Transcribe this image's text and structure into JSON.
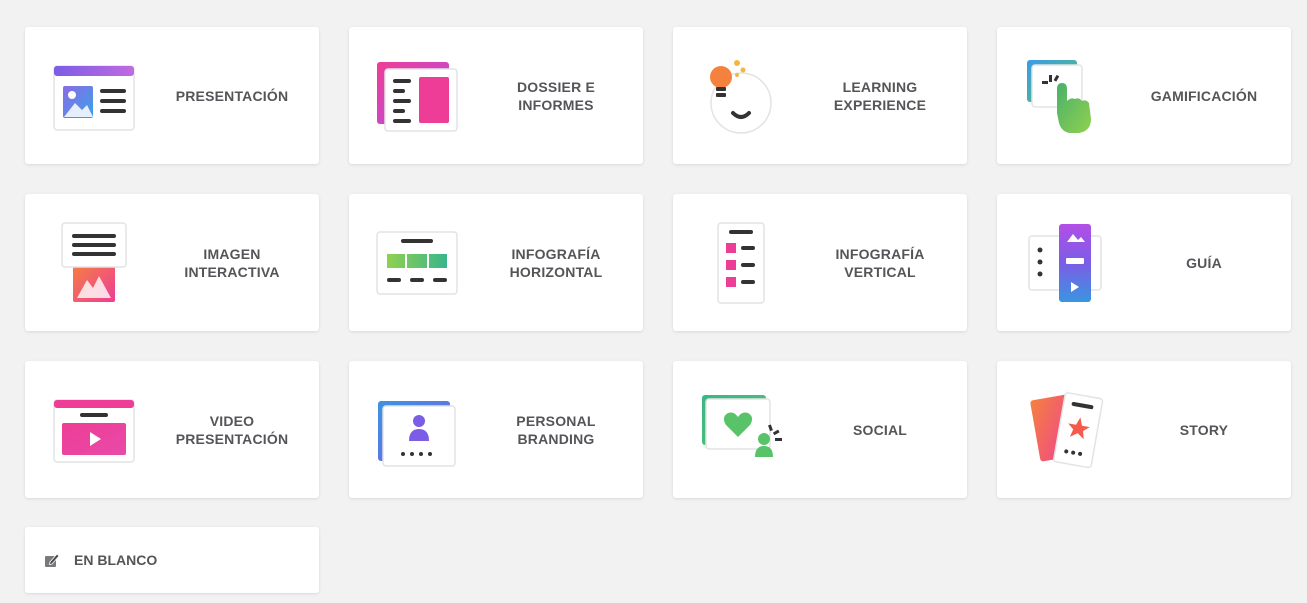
{
  "cards": [
    {
      "id": "presentacion",
      "label": "PRESENTACIÓN",
      "icon": "presentation-icon"
    },
    {
      "id": "dossier",
      "label": "DOSSIER E\nINFORMES",
      "icon": "dossier-icon"
    },
    {
      "id": "learning",
      "label": "LEARNING\nEXPERIENCE",
      "icon": "lightbulb-icon"
    },
    {
      "id": "gamificacion",
      "label": "GAMIFICACIÓN",
      "icon": "touch-hand-icon"
    },
    {
      "id": "imagen",
      "label": "IMAGEN\nINTERACTIVA",
      "icon": "interactive-image-icon"
    },
    {
      "id": "infografia-h",
      "label": "INFOGRAFÍA\nHORIZONTAL",
      "icon": "horizontal-infographic-icon"
    },
    {
      "id": "infografia-v",
      "label": "INFOGRAFÍA\nVERTICAL",
      "icon": "vertical-infographic-icon"
    },
    {
      "id": "guia",
      "label": "GUÍA",
      "icon": "guide-icon"
    },
    {
      "id": "video",
      "label": "VIDEO\nPRESENTACIÓN",
      "icon": "video-icon"
    },
    {
      "id": "branding",
      "label": "PERSONAL\nBRANDING",
      "icon": "profile-card-icon"
    },
    {
      "id": "social",
      "label": "SOCIAL",
      "icon": "heart-social-icon"
    },
    {
      "id": "story",
      "label": "STORY",
      "icon": "story-cards-icon"
    }
  ],
  "blank": {
    "label": "EN BLANCO",
    "icon": "pencil-icon"
  },
  "colors": {
    "background": "#f2f2f3",
    "card": "#ffffff",
    "text": "#555559",
    "purple": "#7b5de6",
    "pink": "#ee3d96",
    "blue": "#3a95e0",
    "green": "#59c36a",
    "orange": "#f5813f"
  }
}
